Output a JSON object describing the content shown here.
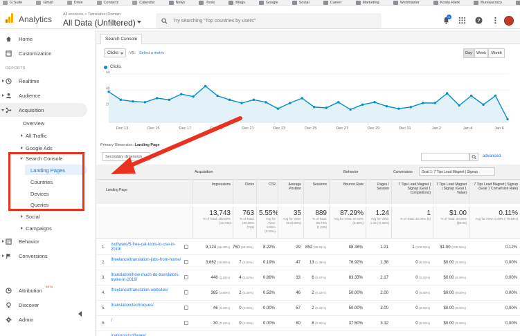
{
  "bookmarks": [
    {
      "label": "G Suite",
      "icon": "gsuite-icon"
    },
    {
      "label": "Gmail",
      "icon": "gmail-icon"
    },
    {
      "label": "Drive",
      "icon": "drive-icon"
    },
    {
      "label": "Contacts",
      "icon": "contacts-icon"
    },
    {
      "label": "Calendar",
      "icon": "calendar-icon"
    },
    {
      "label": "News",
      "icon": "folder-icon"
    },
    {
      "label": "Tools",
      "icon": "folder-icon"
    },
    {
      "label": "Blogs",
      "icon": "folder-icon"
    },
    {
      "label": "Google",
      "icon": "folder-icon"
    },
    {
      "label": "Social",
      "icon": "folder-icon"
    },
    {
      "label": "Career",
      "icon": "folder-icon"
    },
    {
      "label": "Marketing",
      "icon": "folder-icon"
    },
    {
      "label": "Webmaster",
      "icon": "folder-icon"
    },
    {
      "label": "Koala Rank",
      "icon": "folder-icon"
    },
    {
      "label": "Bureaucracy",
      "icon": "folder-icon"
    },
    {
      "label": "Bootstrapping",
      "icon": "folder-icon"
    }
  ],
  "header": {
    "app_name": "Analytics",
    "breadcrumb": "All accounts > Translation Domain",
    "view": "All Data (Unfiltered)",
    "search_placeholder": "Try searching \"Top countries by users\"",
    "notification_count": "1",
    "colors": {
      "logo_orange": "#f9ab00",
      "logo_dark": "#e37400",
      "notif": "#1a73e8"
    }
  },
  "sidebar": {
    "items": [
      {
        "label": "Home",
        "icon": "home-icon"
      },
      {
        "label": "Customization",
        "icon": "customization-icon"
      },
      {
        "section": "REPORTS"
      },
      {
        "label": "Realtime",
        "icon": "clock-icon"
      },
      {
        "label": "Audience",
        "icon": "person-icon"
      },
      {
        "label": "Acquisition",
        "icon": "acquisition-icon"
      },
      {
        "label": "Overview"
      },
      {
        "label": "All Traffic"
      },
      {
        "label": "Google Ads"
      },
      {
        "label": "Search Console"
      },
      {
        "label": "Landing Pages"
      },
      {
        "label": "Countries"
      },
      {
        "label": "Devices"
      },
      {
        "label": "Queries"
      },
      {
        "label": "Social"
      },
      {
        "label": "Campaigns"
      },
      {
        "label": "Behavior",
        "icon": "behavior-icon"
      },
      {
        "label": "Conversions",
        "icon": "flag-icon"
      },
      {
        "label": "Attribution",
        "icon": "attribution-icon",
        "badge": "BETA"
      },
      {
        "label": "Discover",
        "icon": "lightbulb-icon"
      },
      {
        "label": "Admin",
        "icon": "gear-icon"
      }
    ]
  },
  "report": {
    "tab": "Search Console",
    "metric": "Clicks",
    "vs": "VS.",
    "select_metric": "Select a metric",
    "granularity": [
      "Day",
      "Week",
      "Month"
    ],
    "active_granularity": "Day",
    "legend": "Clicks",
    "primary_dimension_label": "Primary Dimension:",
    "primary_dimension": "Landing Page",
    "secondary_dimension": "Secondary dimension",
    "advanced": "advanced"
  },
  "chart_data": {
    "type": "line",
    "series": [
      {
        "name": "Clicks",
        "values": [
          38,
          28,
          26,
          25,
          30,
          28,
          35,
          32,
          45,
          33,
          28,
          24,
          28,
          25,
          17,
          24,
          30,
          19,
          18,
          25,
          16,
          22,
          25,
          20,
          17,
          19,
          24,
          24,
          36,
          21,
          33,
          22,
          33,
          4
        ]
      }
    ],
    "x_tick_labels": [
      "Dec 13",
      "Dec 15",
      "Dec 17",
      "Dec 19",
      "Dec 21",
      "Dec 23",
      "Dec 25",
      "Dec 27",
      "Dec 29",
      "Dec 31",
      "Jan 2",
      "Jan 4",
      "Jan 6"
    ],
    "y_tick_labels": [
      "60",
      "40",
      "20"
    ],
    "color": "#058dc7",
    "fill": "#e3f1f9"
  },
  "table": {
    "dimension_header": "Landing Page",
    "groups": {
      "acquisition": "Acquisition",
      "behavior": "Behavior",
      "conversions": "Conversions",
      "goal_select": "Goal 1: 7 Tips Lead Magnet | Signup"
    },
    "columns": [
      "Impressions",
      "Clicks",
      "CTR",
      "Average Position",
      "Sessions",
      "Bounce Rate",
      "Pages / Session",
      "7 Tips Lead Magnet | Signup (Goal 1 Completions)",
      "7 Tips Lead Magnet | Signup (Goal 1 Value)",
      "7 Tips Lead Magnet | Signup (Goal 1 Conversion Rate)"
    ],
    "totals": [
      {
        "big": "13,743",
        "small": "% of Total: 100.00% (13,743)"
      },
      {
        "big": "763",
        "small": "% of Total: 100.00% (763)"
      },
      {
        "big": "5.55%",
        "small": "Avg for View: 5.55% (0.00%)"
      },
      {
        "big": "35",
        "small": "Avg for View: 35 (0.00%)"
      },
      {
        "big": "889",
        "small": "% of Total: 86.73% (1,025)"
      },
      {
        "big": "87.29%",
        "small": "Avg for View: 87.02% (0.30%)"
      },
      {
        "big": "1.24",
        "small": "Avg for View: 1.25 (-0.56%)"
      },
      {
        "big": "1",
        "small": "% of Total: 20.00% (5)"
      },
      {
        "big": "$1.00",
        "small": "% of Total: 20.00% ($5.00)"
      },
      {
        "big": "0.11%",
        "small": "Avg for View: 0.49% (-76.94%)"
      }
    ],
    "rows": [
      {
        "n": "1.",
        "page": "/software/5-free-cat-tools-to-use-in-2019/",
        "imp": "9,124",
        "imp_pct": "(66.39%)",
        "clicks": "750",
        "clicks_pct": "(98.30%)",
        "ctr": "8.22%",
        "pos": "29",
        "sess": "852",
        "sess_pct": "(95.84%)",
        "bounce": "88.38%",
        "pps": "1.21",
        "g1c": "1",
        "g1c_pct": "(100.00%)",
        "g1v": "$1.00",
        "g1v_pct": "(100.00%)",
        "g1r": "0.12%"
      },
      {
        "n": "2.",
        "page": "/freelance/translation-jobs-from-home/",
        "imp": "3,662",
        "imp_pct": "(26.65%)",
        "clicks": "7",
        "clicks_pct": "(0.92%)",
        "ctr": "0.19%",
        "pos": "47",
        "sess": "13",
        "sess_pct": "(1.46%)",
        "bounce": "76.92%",
        "pps": "1.38",
        "g1c": "0",
        "g1c_pct": "(0.00%)",
        "g1v": "$0.00",
        "g1v_pct": "(0.00%)",
        "g1r": "0.00%"
      },
      {
        "n": "3.",
        "page": "/translation/how-much-do-translators-make-in-2019/",
        "imp": "448",
        "imp_pct": "(3.26%)",
        "clicks": "4",
        "clicks_pct": "(0.52%)",
        "ctr": "0.89%",
        "pos": "33",
        "sess": "6",
        "sess_pct": "(0.67%)",
        "bounce": "83.33%",
        "pps": "2.17",
        "g1c": "0",
        "g1c_pct": "(0.00%)",
        "g1v": "$0.00",
        "g1v_pct": "(0.00%)",
        "g1r": "0.00%"
      },
      {
        "n": "4.",
        "page": "/freelance/translation-websites/",
        "imp": "385",
        "imp_pct": "(2.80%)",
        "clicks": "2",
        "clicks_pct": "(0.26%)",
        "ctr": "0.52%",
        "pos": "46",
        "sess": "2",
        "sess_pct": "(0.22%)",
        "bounce": "50.00%",
        "pps": "2.00",
        "g1c": "0",
        "g1c_pct": "(0.00%)",
        "g1v": "$0.00",
        "g1v_pct": "(0.00%)",
        "g1r": "0.00%"
      },
      {
        "n": "5.",
        "page": "/translation/techniques/",
        "imp": "46",
        "imp_pct": "(0.33%)",
        "clicks": "0",
        "clicks_pct": "(0.00%)",
        "ctr": "0.00%",
        "pos": "57",
        "sess": "2",
        "sess_pct": "(0.22%)",
        "bounce": "50.00%",
        "pps": "3.00",
        "g1c": "0",
        "g1c_pct": "(0.00%)",
        "g1v": "$0.00",
        "g1v_pct": "(0.00%)",
        "g1r": "0.00%"
      },
      {
        "n": "6.",
        "page": "/",
        "imp": "30",
        "imp_pct": "(0.22%)",
        "clicks": "0",
        "clicks_pct": "(0.00%)",
        "ctr": "0.00%",
        "pos": "80",
        "sess": "8",
        "sess_pct": "(0.90%)",
        "bounce": "37.50%",
        "pps": "3.12",
        "g1c": "0",
        "g1c_pct": "(0.00%)",
        "g1v": "$0.00",
        "g1v_pct": "(0.00%)",
        "g1r": "0.00%"
      },
      {
        "n": "7.",
        "page": "/category/software/",
        "imp": "25",
        "imp_pct": "(0.18%)",
        "clicks": "0",
        "clicks_pct": "(0.00%)",
        "ctr": "0.00%",
        "pos": "73",
        "sess": "0",
        "sess_pct": "(0.00%)",
        "bounce": "0.00%",
        "pps": "0.00",
        "g1c": "0",
        "g1c_pct": "(0.00%)",
        "g1v": "$0.00",
        "g1v_pct": "(0.00%)",
        "g1r": "0.00%"
      }
    ]
  },
  "annotation": {
    "color": "#e8321f"
  }
}
